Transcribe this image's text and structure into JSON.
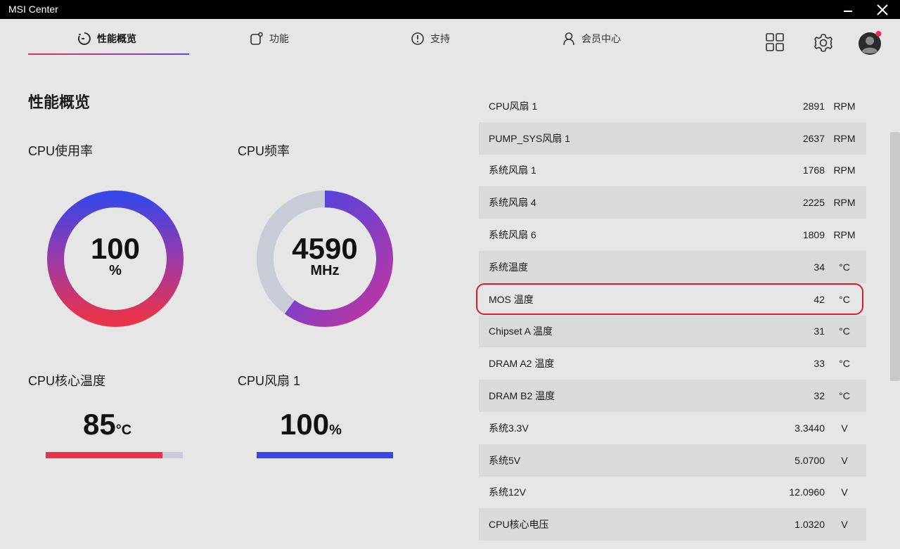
{
  "window": {
    "title": "MSI Center"
  },
  "nav": {
    "tabs": [
      {
        "label": "性能概览"
      },
      {
        "label": "功能"
      },
      {
        "label": "支持"
      },
      {
        "label": "会员中心"
      }
    ],
    "active_tab": "性能概览"
  },
  "overview": {
    "title": "性能概览",
    "cpu_usage": {
      "label": "CPU使用率",
      "value": "100",
      "unit": "%",
      "fraction": 1.0
    },
    "cpu_freq": {
      "label": "CPU频率",
      "value": "4590",
      "unit": "MHz",
      "fraction": 0.6
    },
    "cpu_temp": {
      "label": "CPU核心温度",
      "value": "85",
      "unit": "°C",
      "fraction": 0.85
    },
    "cpu_fan": {
      "label": "CPU风扇 1",
      "value": "100",
      "unit": "%",
      "fraction": 1.0
    }
  },
  "sensors": [
    {
      "name": "CPU风扇 1",
      "value": "2891",
      "unit": "RPM"
    },
    {
      "name": "PUMP_SYS风扇 1",
      "value": "2637",
      "unit": "RPM"
    },
    {
      "name": "系统风扇 1",
      "value": "1768",
      "unit": "RPM"
    },
    {
      "name": "系统风扇 4",
      "value": "2225",
      "unit": "RPM"
    },
    {
      "name": "系统风扇 6",
      "value": "1809",
      "unit": "RPM"
    },
    {
      "name": "系统温度",
      "value": "34",
      "unit": "°C"
    },
    {
      "name": "MOS 温度",
      "value": "42",
      "unit": "°C"
    },
    {
      "name": "Chipset A 温度",
      "value": "31",
      "unit": "°C"
    },
    {
      "name": "DRAM A2 温度",
      "value": "33",
      "unit": "°C"
    },
    {
      "name": "DRAM B2 温度",
      "value": "32",
      "unit": "°C"
    },
    {
      "name": "系统3.3V",
      "value": "3.3440",
      "unit": "V"
    },
    {
      "name": "系统5V",
      "value": "5.0700",
      "unit": "V"
    },
    {
      "name": "系统12V",
      "value": "12.0960",
      "unit": "V"
    },
    {
      "name": "CPU核心电压",
      "value": "1.0320",
      "unit": "V"
    }
  ],
  "colors": {
    "gradient_start": "#e8334a",
    "gradient_mid": "#9a3aa8",
    "gradient_end": "#3a46e6",
    "track": "#c8ccd6",
    "temp_bar": "#e8334a",
    "fan_bar": "#3a46e6",
    "highlight": "#e01b24"
  }
}
